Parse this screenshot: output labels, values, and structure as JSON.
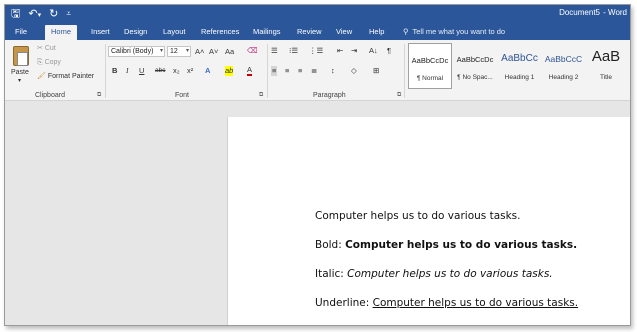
{
  "titlebar": {
    "save_glyph": "🖫",
    "undo_glyph": "↶",
    "undo_dropdown": "▾",
    "redo_glyph": "↻",
    "customize_glyph": "⩡",
    "document_title": "Document5",
    "app_sep": "-",
    "app_name": "Word"
  },
  "tabs": [
    {
      "label": "File"
    },
    {
      "label": "Home"
    },
    {
      "label": "Insert"
    },
    {
      "label": "Design"
    },
    {
      "label": "Layout"
    },
    {
      "label": "References"
    },
    {
      "label": "Mailings"
    },
    {
      "label": "Review"
    },
    {
      "label": "View"
    },
    {
      "label": "Help"
    }
  ],
  "tell_me": {
    "icon": "⚲",
    "placeholder": "Tell me what you want to do"
  },
  "clipboard": {
    "paste": "Paste",
    "paste_arrow": "▾",
    "cut": "Cut",
    "copy": "Copy",
    "format_painter": "Format Painter",
    "label": "Clipboard",
    "cut_icon": "✂",
    "copy_icon": "⎘",
    "painter_icon": "🖌"
  },
  "font": {
    "family": "Calibri (Body)",
    "size": "12",
    "grow": "A˄",
    "shrink": "A˅",
    "change_case": "Aa",
    "clear_format": "⌫",
    "bold": "B",
    "italic": "I",
    "underline": "U",
    "strikethrough": "abc",
    "subscript": "x₂",
    "superscript": "x²",
    "text_effects": "A",
    "highlight": "ab",
    "font_color": "A",
    "label": "Font"
  },
  "paragraph": {
    "bullets": "☰",
    "numbering": "⁝☰",
    "multilevel": "⋮☰",
    "decrease_indent": "⇤",
    "increase_indent": "⇥",
    "sort": "A↓",
    "show_marks": "¶",
    "align_left": "≡",
    "center": "≡",
    "align_right": "≡",
    "justify": "≣",
    "line_spacing": "↕",
    "shading": "◇",
    "borders": "⊞",
    "label": "Paragraph"
  },
  "styles": [
    {
      "sample": "AaBbCcDc",
      "name": "¶ Normal"
    },
    {
      "sample": "AaBbCcDc",
      "name": "¶ No Spac..."
    },
    {
      "sample": "AaBbCc",
      "name": "Heading 1"
    },
    {
      "sample": "AaBbCcC",
      "name": "Heading 2"
    },
    {
      "sample": "AaB",
      "name": "Title"
    }
  ],
  "document": {
    "line1": "Computer helps us to do various tasks.",
    "line2_label": "Bold: ",
    "line2_text": "Computer helps us to do various tasks.",
    "line3_label": "Italic: ",
    "line3_text": "Computer helps us to do various tasks.",
    "line4_label": "Underline: ",
    "line4_text": "Computer helps us to do various tasks."
  },
  "colors": {
    "brand": "#2b579a",
    "ribbon": "#f3f3f3",
    "workspace": "#e6e6e6"
  }
}
